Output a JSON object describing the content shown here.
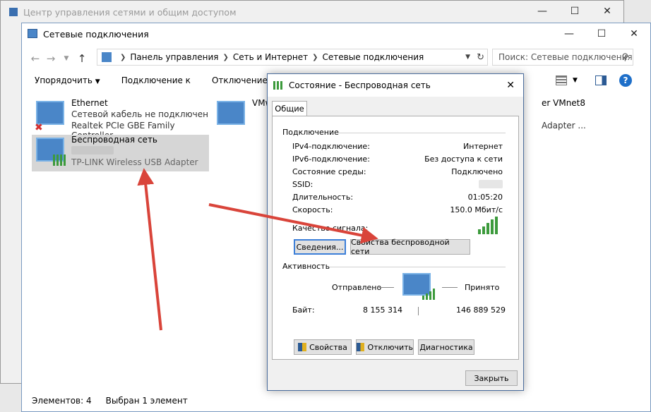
{
  "back_window": {
    "title": "Центр управления сетями и общим доступом"
  },
  "window": {
    "title": "Сетевые подключения"
  },
  "address": {
    "path": [
      "Панель управления",
      "Сеть и Интернет",
      "Сетевые подключения"
    ],
    "search_placeholder": "Поиск: Сетевые подключения"
  },
  "toolbar": {
    "organize": "Упорядочить",
    "connect": "Подключение к",
    "disconnect": "Отключение сете"
  },
  "connections": [
    {
      "name": "Ethernet",
      "status": "Сетевой кабель не подключен",
      "adapter": "Realtek PCIe GBE Family Controller"
    },
    {
      "name": "Беспроводная сеть",
      "status": "",
      "adapter": "TP-LINK Wireless USB Adapter"
    },
    {
      "name": "VMw",
      "status": "",
      "adapter": ""
    },
    {
      "name": "er VMnet8",
      "status": "",
      "adapter": "Adapter ..."
    }
  ],
  "statusbar": {
    "items": "Элементов: 4",
    "selected": "Выбран 1 элемент"
  },
  "dialog": {
    "title": "Состояние - Беспроводная сеть",
    "tab": "Общие",
    "connection_header": "Подключение",
    "rows": [
      {
        "label": "IPv4-подключение:",
        "value": "Интернет"
      },
      {
        "label": "IPv6-подключение:",
        "value": "Без доступа к сети"
      },
      {
        "label": "Состояние среды:",
        "value": "Подключено"
      },
      {
        "label": "SSID:",
        "value": ""
      },
      {
        "label": "Длительность:",
        "value": "01:05:20"
      },
      {
        "label": "Скорость:",
        "value": "150.0 Мбит/с"
      }
    ],
    "signal_label": "Качество сигнала:",
    "details_button": "Сведения...",
    "wireless_props_button": "Свойства беспроводной сети",
    "activity_header": "Активность",
    "sent_label": "Отправлено",
    "received_label": "Принято",
    "bytes_label": "Байт:",
    "bytes_sent": "8 155 314",
    "bytes_received": "146 889 529",
    "properties_button": "Свойства",
    "disable_button": "Отключить",
    "diagnose_button": "Диагностика",
    "close_button": "Закрыть"
  }
}
